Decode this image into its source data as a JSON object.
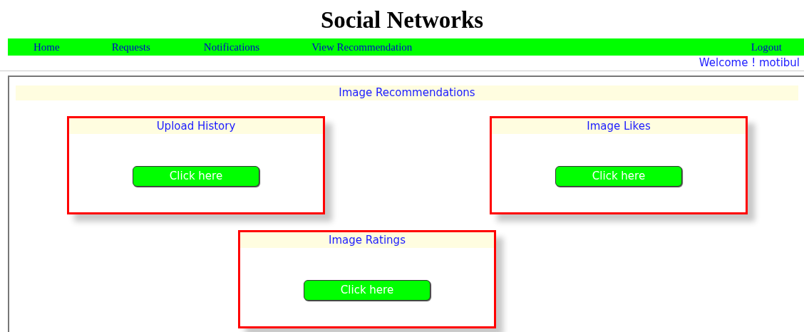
{
  "title": "Social Networks",
  "nav": {
    "items": [
      "Home",
      "Requests",
      "Notifications",
      "View Recommendation"
    ],
    "logout": "Logout"
  },
  "welcome": "Welcome ! motibul",
  "section": {
    "heading": "Image Recommendations",
    "cards": [
      {
        "title": "Upload History",
        "button": "Click here"
      },
      {
        "title": "Image Likes",
        "button": "Click here"
      },
      {
        "title": "Image Ratings",
        "button": "Click here"
      }
    ]
  }
}
